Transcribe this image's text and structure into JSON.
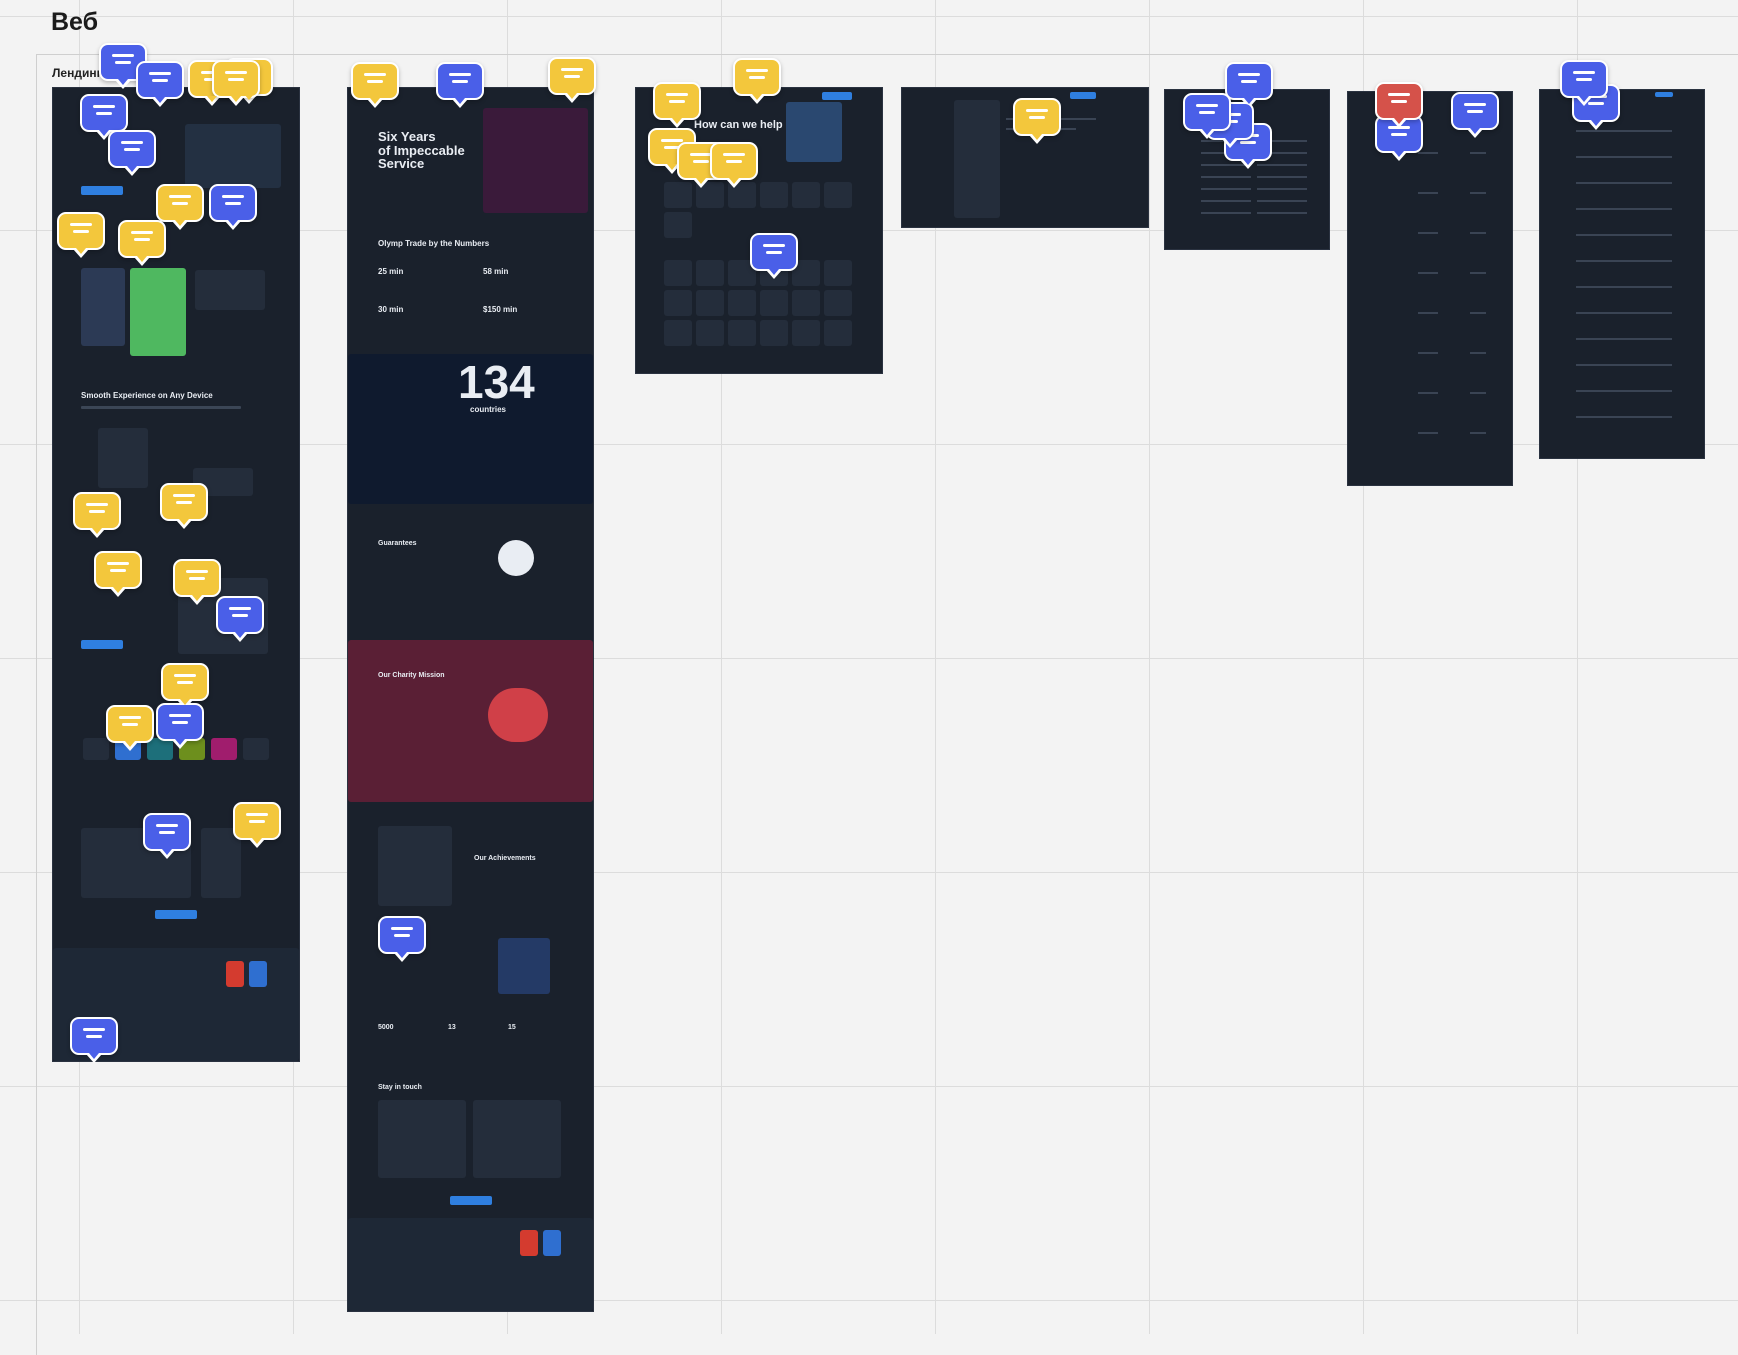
{
  "board": {
    "title": "Веб",
    "section_label": "Лендинг"
  },
  "frames": {
    "landing_two": {
      "hero_title": "Six Years\nof Impeccable\nService",
      "numbers_heading": "Olymp Trade by the Numbers",
      "stats": [
        "25 min",
        "58 min",
        "30 min",
        "$150 min"
      ],
      "big_number": "134",
      "big_number_caption": "countries",
      "guarantees_heading": "Guarantees",
      "charity_heading": "Our Charity Mission",
      "achievements_heading": "Our Achievements",
      "achievement_stats": [
        "5000",
        "13",
        "15"
      ],
      "stay_heading": "Stay in touch"
    },
    "help_center": {
      "title": "How can we help"
    },
    "landing_one": {
      "device_heading": "Smooth Experience on Any Device"
    }
  },
  "markers": {
    "colors": {
      "blue": "#4a5fe8",
      "yellow": "#f3c73c",
      "red": "#d5524a"
    }
  }
}
